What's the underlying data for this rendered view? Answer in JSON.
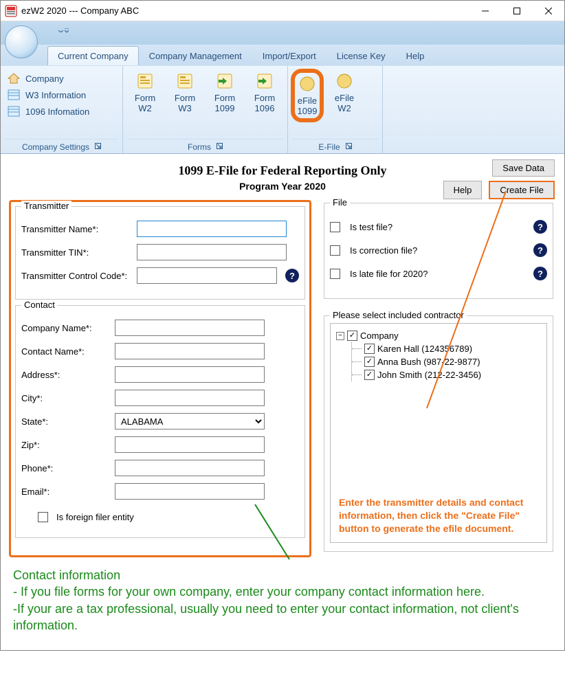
{
  "window": {
    "title": "ezW2 2020 --- Company ABC"
  },
  "tabs": {
    "current_company": "Current Company",
    "company_management": "Company Management",
    "import_export": "Import/Export",
    "license_key": "License Key",
    "help": "Help"
  },
  "ribbon": {
    "settings_group": "Company Settings",
    "forms_group": "Forms",
    "efile_group": "E-File",
    "side_items": {
      "company": "Company",
      "w3_info": "W3 Information",
      "i1096_info": "1096 Infomation"
    },
    "form_buttons": {
      "w2a": "Form",
      "w2b": "W2",
      "w3a": "Form",
      "w3b": "W3",
      "f1099a": "Form",
      "f1099b": "1099",
      "f1096a": "Form",
      "f1096b": "1096",
      "e1099a": "eFile",
      "e1099b": "1099",
      "ew2a": "eFile",
      "ew2b": "W2"
    }
  },
  "page": {
    "title": "1099 E-File for Federal Reporting Only",
    "subtitle": "Program Year 2020",
    "buttons": {
      "save_data": "Save Data",
      "help": "Help",
      "create_file": "Create File"
    }
  },
  "transmitter": {
    "legend": "Transmitter",
    "name_label": "Transmitter Name*:",
    "name_value": "",
    "tin_label": "Transmitter TIN*:",
    "tin_value": "",
    "tcc_label": "Transmitter Control Code*:",
    "tcc_value": ""
  },
  "contact": {
    "legend": "Contact",
    "company_label": "Company Name*:",
    "company_value": "",
    "name_label": "Contact Name*:",
    "name_value": "",
    "address_label": "Address*:",
    "address_value": "",
    "city_label": "City*:",
    "city_value": "",
    "state_label": "State*:",
    "state_value": "ALABAMA",
    "zip_label": "Zip*:",
    "zip_value": "",
    "phone_label": "Phone*:",
    "phone_value": "",
    "email_label": "Email*:",
    "email_value": "",
    "foreign_label": "Is foreign filer entity"
  },
  "file_opts": {
    "legend": "File",
    "is_test": "Is test file?",
    "is_correction": "Is correction file?",
    "is_late": "Is late file for 2020?"
  },
  "contractors": {
    "legend": "Please select included contractor",
    "root": "Company",
    "items": [
      "Karen Hall (124356789)",
      "Anna Bush (987-22-9877)",
      "John Smith (212-22-3456)"
    ]
  },
  "annotations": {
    "orange": "Enter the transmitter details and contact information, then click the \"Create File\" button to generate the efile document.",
    "green_heading": "Contact information",
    "green_line1": "- If you file forms for your own company, enter your company contact information here.",
    "green_line2": "-If your are a tax professional, usually you need to enter your contact information, not client's information."
  },
  "icons": {
    "question": "?",
    "check": "✓",
    "minus": "−"
  }
}
